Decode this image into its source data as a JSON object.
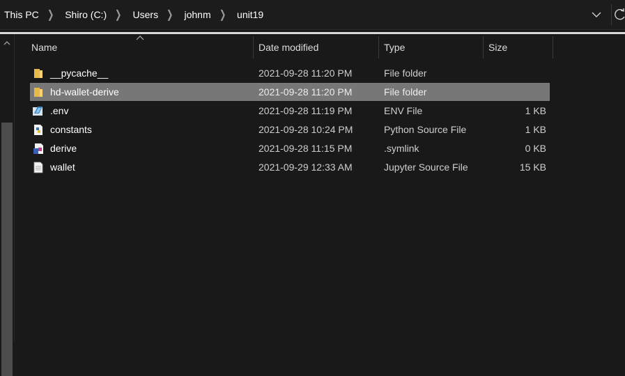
{
  "address_bar": {
    "crumbs": [
      "This PC",
      "Shiro (C:)",
      "Users",
      "johnm",
      "unit19"
    ]
  },
  "columns": {
    "name": "Name",
    "date_modified": "Date modified",
    "type": "Type",
    "size": "Size"
  },
  "files": [
    {
      "name": "__pycache__",
      "date": "2021-09-28 11:20 PM",
      "type": "File folder",
      "size": "",
      "icon": "folder-icon",
      "selected": false
    },
    {
      "name": "hd-wallet-derive",
      "date": "2021-09-28 11:20 PM",
      "type": "File folder",
      "size": "",
      "icon": "folder-icon",
      "selected": true
    },
    {
      "name": ".env",
      "date": "2021-09-28 11:19 PM",
      "type": "ENV File",
      "size": "1 KB",
      "icon": "env-file-icon",
      "selected": false
    },
    {
      "name": "constants",
      "date": "2021-09-28 10:24 PM",
      "type": "Python Source File",
      "size": "1 KB",
      "icon": "python-file-icon",
      "selected": false
    },
    {
      "name": "derive",
      "date": "2021-09-28 11:15 PM",
      "type": ".symlink",
      "size": "0 KB",
      "icon": "symlink-file-icon",
      "selected": false
    },
    {
      "name": "wallet",
      "date": "2021-09-29 12:33 AM",
      "type": "Jupyter Source File",
      "size": "15 KB",
      "icon": "document-file-icon",
      "selected": false
    }
  ],
  "colors": {
    "background": "#191919",
    "selected_row": "#777777",
    "folder": "#e8b84a"
  }
}
